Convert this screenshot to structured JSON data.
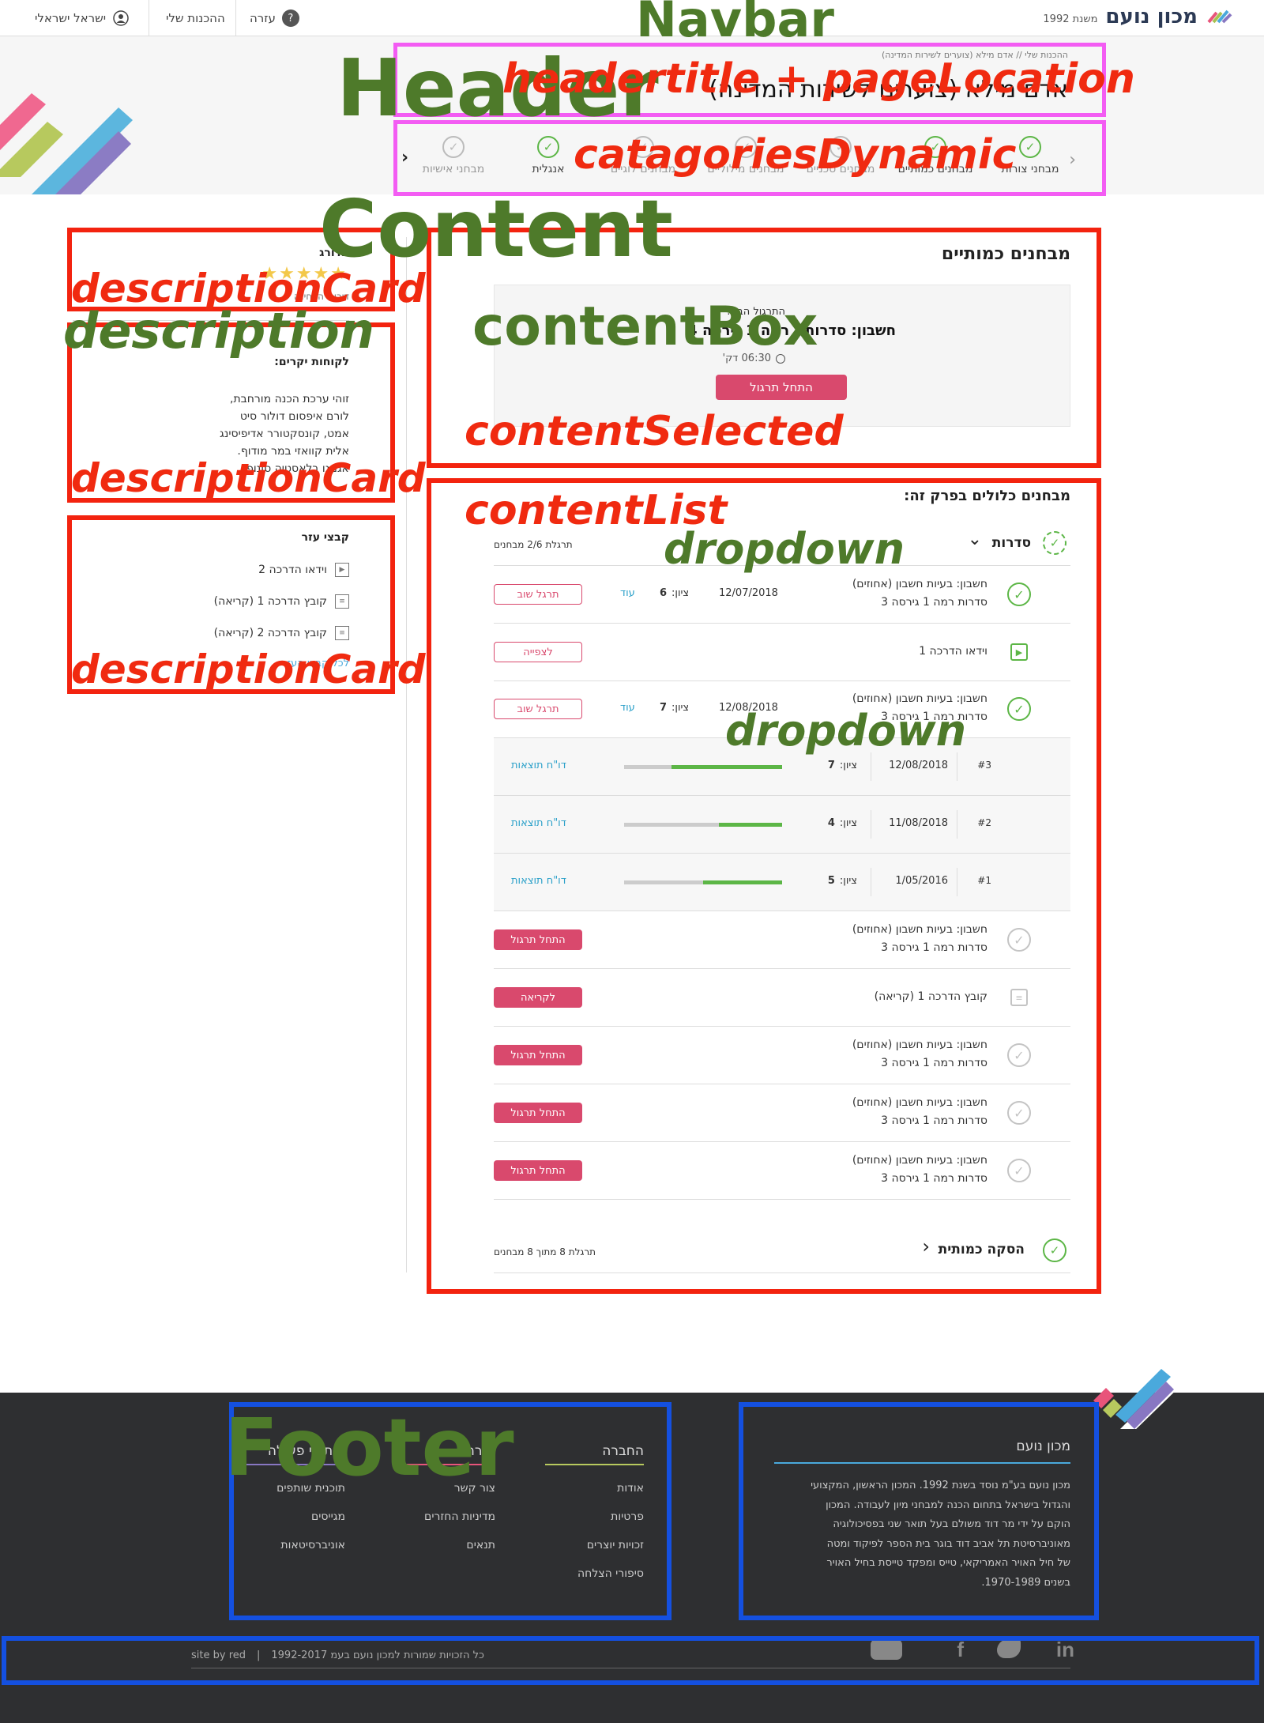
{
  "annotations": {
    "navbar": "Navbar",
    "header": "Header",
    "headertitle": "headertitle + pageLocation",
    "categories": "catagoriesDynamic",
    "content": "Content",
    "content_box": "contentBox",
    "content_selected": "contentSelected",
    "content_list": "contentList",
    "dropdown": "dropdown",
    "description_card": "descriptionCard",
    "description": "description",
    "footer": "Footer"
  },
  "navbar": {
    "logo_text": "מכון נועם",
    "logo_since": "משנת 1992",
    "user": "ישראל ישראלי",
    "my_prep": "ההכנות שלי",
    "help": "עזרה"
  },
  "header": {
    "breadcrumb": "ההכנות שלי // אדם מילא (צוערים לשירות המדינה)",
    "title": "אדם מילא (צוערים לשירות המדינה)",
    "categories": [
      {
        "label": "מבחני צורות",
        "done": true
      },
      {
        "label": "מבחנים כמותיים",
        "done": true
      },
      {
        "label": "מבחנים טכניים",
        "done": false
      },
      {
        "label": "מבחנים מילוליים",
        "done": false
      },
      {
        "label": "מבחנים לוגיים",
        "done": false
      },
      {
        "label": "אנגלית",
        "done": true
      },
      {
        "label": "מבחני אישיות",
        "done": false
      }
    ]
  },
  "content": {
    "section_title": "מבחנים כמותיים",
    "next_label": "התרגול הבא:",
    "next_title": "חשבון: סדרות - רמה 1 גירסה 4",
    "next_time": "06:30 דק'",
    "start_button": "התחל תרגול",
    "list_title": "מבחנים כלולים בפרק זה:",
    "dropdown_title": "סדרות",
    "dropdown_progress": "תרגלת 2/6 מבחנים",
    "items": [
      {
        "title": "חשבון: בעיות חשבון (אחוזים)",
        "sub": "סדרות רמה 1 גירסה 3",
        "date": "12/07/2018",
        "score_label": "ציון:",
        "score": "6",
        "more": "עוד",
        "button": "תרגל שוב"
      },
      {
        "title": "וידאו הדרכה 1",
        "button": "לצפייה"
      },
      {
        "title": "חשבון: בעיות חשבון (אחוזים)",
        "sub": "סדרות רמה 1 גירסה 3",
        "date": "12/08/2018",
        "score_label": "ציון:",
        "score": "7",
        "more": "עוד",
        "button": "תרגל שוב"
      },
      {
        "title": "חשבון: בעיות חשבון (אחוזים)",
        "sub": "סדרות רמה 1 גירסה 3",
        "button": "התחל תרגול"
      },
      {
        "title": "קובץ הדרכה 1 (קריאה)",
        "button": "לקריאה"
      },
      {
        "title": "חשבון: בעיות חשבון (אחוזים)",
        "sub": "סדרות רמה 1 גירסה 3",
        "button": "התחל תרגול"
      },
      {
        "title": "חשבון: בעיות חשבון (אחוזים)",
        "sub": "סדרות רמה 1 גירסה 3",
        "button": "התחל תרגול"
      },
      {
        "title": "חשבון: בעיות חשבון (אחוזים)",
        "sub": "סדרות רמה 1 גירסה 3",
        "button": "התחל תרגול"
      }
    ],
    "attempts": [
      {
        "num": "#3",
        "date": "12/08/2018",
        "score_label": "ציון:",
        "score": "7",
        "report": "דו\"ח תוצאות",
        "fill": 0.7
      },
      {
        "num": "#2",
        "date": "11/08/2018",
        "score_label": "ציון:",
        "score": "4",
        "report": "דו\"ח תוצאות",
        "fill": 0.4
      },
      {
        "num": "#1",
        "date": "1/05/2016",
        "score_label": "ציון:",
        "score": "5",
        "report": "דו\"ח תוצאות",
        "fill": 0.5
      }
    ],
    "second_dropdown_title": "הסקה כמותית",
    "second_dropdown_progress": "תרגלת 8 מתוך 8 מבחנים"
  },
  "sidebar": {
    "rating_title": "מדורג",
    "rating_sub": "דירוג: הבחינה",
    "tips_title": "לקוחות יקרים:",
    "tips_lines": [
      "זוהי ערכת הכנה מורחבת,",
      "לורם איפסום דולור סיט",
      "אמט, קונסקטורר אדיפיסינג",
      "אלית קוואזי במר מודוף.",
      "אגמנו בלאסטיה סונופ."
    ],
    "files_title": "קבצי עזר",
    "files": [
      "וידאו הדרכה 2",
      "קובץ הדרכה 1 (קריאה)",
      "קובץ הדרכה 2 (קריאה)"
    ],
    "more_link": "לכל קבצי העזר"
  },
  "footer": {
    "about_title": "מכון נועם",
    "about_lines": [
      "מכון נועם בע\"מ נוסד בשנת 1992. המכון הראשון, המקצועי",
      "והגדול בישראל בתחום הכנה למבחני מיון לעבודה. המכון",
      "הוקם על ידי מר דוד משולם בעל תואר  שני בפסיכולוגיה",
      "מאוניברסיטת תל אביב דוד בוגר בית הספר לפיקוד ומטה",
      "של חיל האויר האמריקאי, טייס ומפקד טייסת בחיל האויר",
      "בשנים 1970-1989."
    ],
    "company_title": "החברה",
    "company_links": [
      "אודות",
      "פרטיות",
      "זכויות יוצרים",
      "סיפורי הצלחה"
    ],
    "help_title": "עזרה",
    "help_links": [
      "צור קשר",
      "מדיניות החזרים",
      "תנאים"
    ],
    "partners_title": "שיתופי פעולה",
    "partners_links": [
      "תוכנית שותפים",
      "מגייסים",
      "אוניברסיטאות"
    ],
    "copyright": "כל הזכויות שמורות למכון נועם בעמ 1992-2017",
    "site_by": "site by red",
    "colors": {
      "bg": "#2e2f31",
      "pink": "#d9496d",
      "green": "#5cb646"
    }
  }
}
